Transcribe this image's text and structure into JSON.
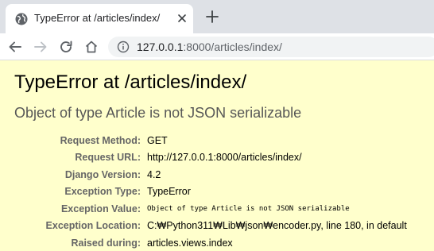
{
  "browser": {
    "tab": {
      "title": "TypeError at /articles/index/"
    },
    "address_bar": {
      "host": "127.0.0.1",
      "rest": ":8000/articles/index/"
    },
    "icons": {
      "favicon": "globe-icon",
      "tab_close": "close-icon",
      "new_tab": "plus-icon",
      "back": "arrow-left-icon",
      "forward": "arrow-right-icon",
      "reload": "reload-icon",
      "home": "home-icon",
      "site_info": "info-icon"
    }
  },
  "error": {
    "title": "TypeError at /articles/index/",
    "message": "Object of type Article is not JSON serializable",
    "rows": [
      {
        "label": "Request Method:",
        "value": "GET"
      },
      {
        "label": "Request URL:",
        "value": "http://127.0.0.1:8000/articles/index/"
      },
      {
        "label": "Django Version:",
        "value": "4.2"
      },
      {
        "label": "Exception Type:",
        "value": "TypeError"
      },
      {
        "label": "Exception Value:",
        "value": "Object of type Article is not JSON serializable"
      },
      {
        "label": "Exception Location:",
        "value": "C:₩Python311₩Lib₩json₩encoder.py, line 180, in default"
      },
      {
        "label": "Raised during:",
        "value": "articles.views.index"
      }
    ]
  },
  "colors": {
    "page_background": "#ffffcc",
    "label_gray": "#666666",
    "tabstrip": "#dee1e6"
  }
}
